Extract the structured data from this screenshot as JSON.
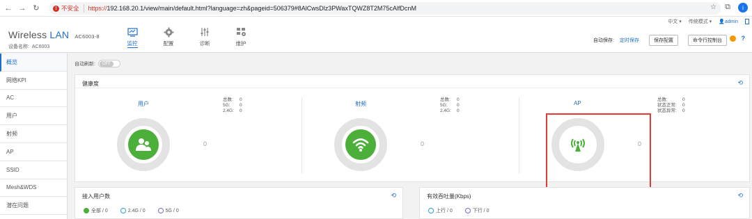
{
  "browser": {
    "insecure_label": "不安全",
    "url_scheme": "https://",
    "url_rest": "192.168.20.1/view/main/default.html?language=zh&pageid=506379#8AlCwsDlz3PWaxTQWZ8T2M75cAlfDcnM",
    "profile_initial": "i"
  },
  "header": {
    "lang": "中文",
    "mode": "传统模式",
    "user": "admin",
    "brand_wireless": "Wireless",
    "brand_lan": "LAN",
    "model": "AC6003-8",
    "device_name_label": "设备名称:",
    "device_name": "AC6003",
    "nav": [
      {
        "label": "监控",
        "icon": "monitor-icon",
        "active": true
      },
      {
        "label": "配置",
        "icon": "gear-icon",
        "active": false
      },
      {
        "label": "诊断",
        "icon": "sliders-icon",
        "active": false
      },
      {
        "label": "维护",
        "icon": "maintenance-icon",
        "active": false
      }
    ],
    "autosave_label": "自动保存:",
    "autosave_value": "定时保存",
    "save_config": "保存配置",
    "cli": "命令行控制台",
    "help": "?"
  },
  "sidebar": {
    "items": [
      {
        "label": "概览",
        "active": true
      },
      {
        "label": "网络KPI"
      },
      {
        "label": "AC"
      },
      {
        "label": "用户"
      },
      {
        "label": "射频"
      },
      {
        "label": "AP"
      },
      {
        "label": "SSID"
      },
      {
        "label": "Mesh&WDS"
      },
      {
        "label": "潜在问题"
      }
    ]
  },
  "main": {
    "auto_refresh_label": "自动刷新:",
    "auto_refresh_state": "OFF",
    "health": {
      "title": "健康度",
      "metrics": [
        {
          "label": "用户",
          "value": "0",
          "stats": [
            {
              "k": "总数:",
              "v": "0"
            },
            {
              "k": "5G:",
              "v": "0"
            },
            {
              "k": "2.4G:",
              "v": "0"
            }
          ]
        },
        {
          "label": "射频",
          "value": "0",
          "stats": [
            {
              "k": "总数:",
              "v": "0"
            },
            {
              "k": "5G:",
              "v": "0"
            },
            {
              "k": "2.4G:",
              "v": "0"
            }
          ]
        },
        {
          "label": "AP",
          "value": "0",
          "stats": [
            {
              "k": "总数:",
              "v": "0"
            },
            {
              "k": "状态正常:",
              "v": "0"
            },
            {
              "k": "状态异常:",
              "v": "0"
            }
          ]
        }
      ]
    },
    "users_panel": {
      "title": "接入用户数",
      "legend": [
        "全部 / 0",
        "2.4G / 0",
        "5G / 0"
      ]
    },
    "throughput_panel": {
      "title": "有效吞吐量(Kbps)",
      "legend": [
        "上行 / 0",
        "下行 / 0"
      ]
    },
    "colors": {
      "accent": "#1e6fc8",
      "green": "#4caf3a",
      "highlight": "#e53935"
    }
  }
}
